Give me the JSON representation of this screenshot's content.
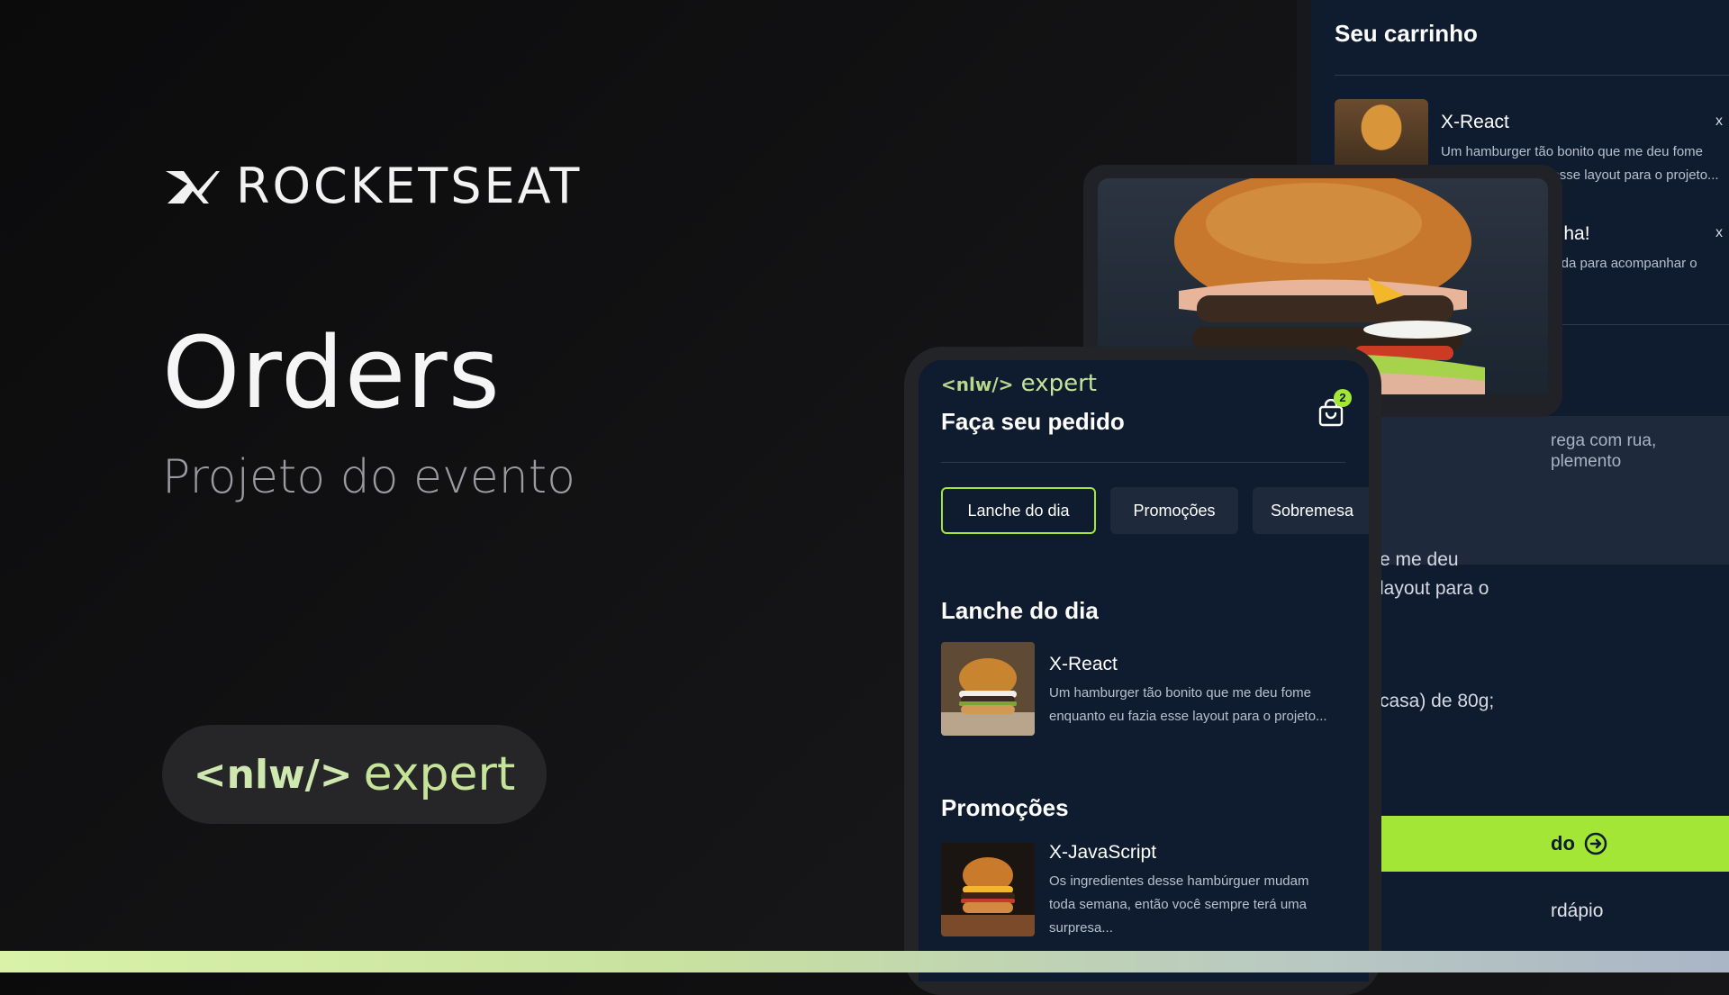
{
  "hero": {
    "brand": "ROCKETSEAT",
    "title": "Orders",
    "subtitle": "Projeto do evento",
    "badge_nlw": "<nlw/>",
    "badge_expert": "expert"
  },
  "cart_panel": {
    "title": "Seu carrinho",
    "item1": {
      "name": "X-React",
      "desc": "Um hamburger tão bonito que me deu fome enquanto eu fazia esse layout para o projeto...",
      "remove": "x"
    },
    "item2": {
      "name": "inha!",
      "desc": "lada para acompanhar o",
      "remove": "x"
    },
    "address_hint": "rega com rua,\nplemento",
    "frag1": "e me deu",
    "frag2": "layout para o",
    "frag3": "casa) de 80g;",
    "button_label": "do",
    "link_label": "rdápio"
  },
  "phone": {
    "logo_nlw": "<nlw/>",
    "logo_expert": "expert",
    "title": "Faça seu pedido",
    "cart_count": "2",
    "tabs": [
      "Lanche do dia",
      "Promoções",
      "Sobremesa"
    ],
    "sections": [
      {
        "heading": "Lanche do dia",
        "item": {
          "name": "X-React",
          "desc": "Um hamburger tão bonito que me deu fome enquanto eu fazia esse layout para o projeto..."
        }
      },
      {
        "heading": "Promoções",
        "item": {
          "name": "X-JavaScript",
          "desc": "Os ingredientes desse hambúrguer mudam toda semana, então você sempre terá uma surpresa..."
        }
      }
    ]
  },
  "colors": {
    "accent": "#a3e635",
    "panel": "#0f1b2e",
    "background": "#0b0b0c"
  }
}
